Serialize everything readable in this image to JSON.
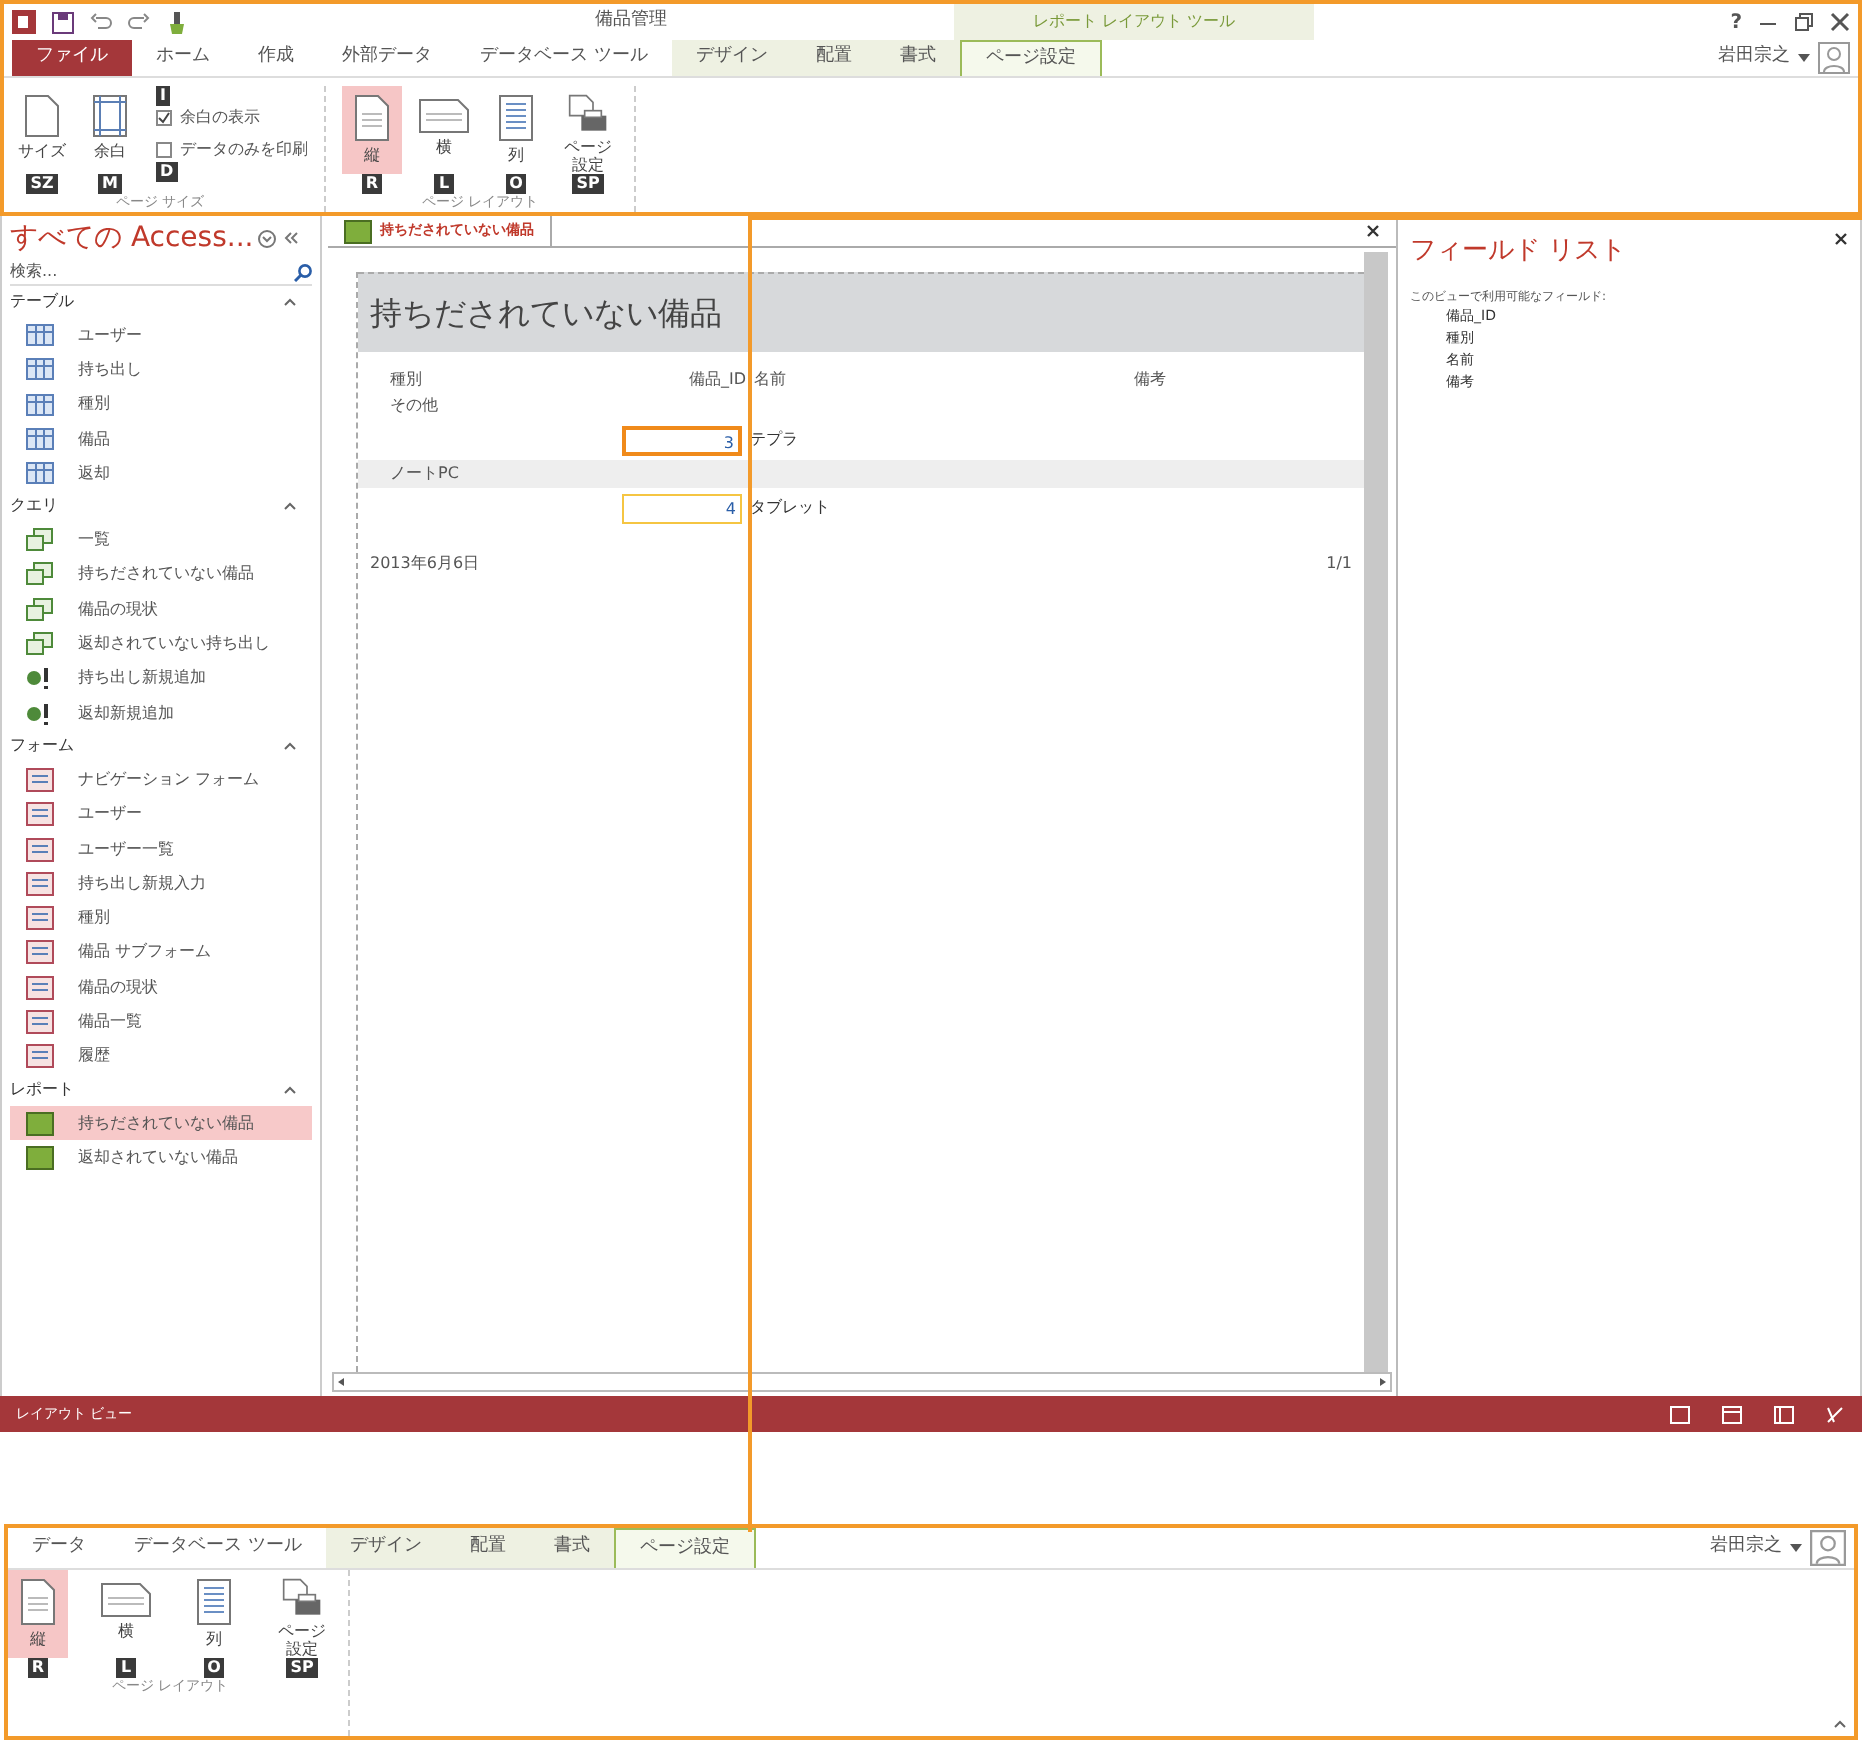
{
  "window": {
    "title": "備品管理",
    "context_tool": "レポート レイアウト ツール",
    "help": "?",
    "user": "岩田宗之"
  },
  "tabs": [
    {
      "label": "ファイル",
      "selected": false,
      "kind": "file"
    },
    {
      "label": "ホーム",
      "selected": false,
      "kind": "normal"
    },
    {
      "label": "作成",
      "selected": false,
      "kind": "normal"
    },
    {
      "label": "外部データ",
      "selected": false,
      "kind": "normal"
    },
    {
      "label": "データベース ツール",
      "selected": false,
      "kind": "normal"
    },
    {
      "label": "デザイン",
      "selected": false,
      "kind": "context"
    },
    {
      "label": "配置",
      "selected": false,
      "kind": "context"
    },
    {
      "label": "書式",
      "selected": false,
      "kind": "context"
    },
    {
      "label": "ページ設定",
      "selected": true,
      "kind": "context"
    }
  ],
  "ribbon": {
    "page_size": {
      "label": "ページ サイズ",
      "buttons": [
        {
          "label": "サイズ",
          "key": "SZ"
        },
        {
          "label": "余白",
          "key": "M"
        }
      ],
      "checks": [
        {
          "label": "余白の表示",
          "checked": true,
          "key": "I"
        },
        {
          "label": "データのみを印刷",
          "checked": false,
          "key": "D"
        }
      ]
    },
    "page_layout": {
      "label": "ページ レイアウト",
      "buttons": [
        {
          "label": "縦",
          "key": "R",
          "selected": true
        },
        {
          "label": "横",
          "key": "L",
          "selected": false
        },
        {
          "label": "列",
          "key": "O",
          "selected": false
        },
        {
          "label": "ページ設定",
          "key": "SP",
          "selected": false
        }
      ]
    }
  },
  "nav": {
    "title": "すべての Access...",
    "search": {
      "placeholder": "検索..."
    },
    "sections": [
      {
        "label": "テーブル",
        "items": [
          {
            "label": "ユーザー",
            "kind": "table",
            "selected": false
          },
          {
            "label": "持ち出し",
            "kind": "table",
            "selected": false
          },
          {
            "label": "種別",
            "kind": "table",
            "selected": false
          },
          {
            "label": "備品",
            "kind": "table",
            "selected": false
          },
          {
            "label": "返却",
            "kind": "table",
            "selected": false
          }
        ]
      },
      {
        "label": "クエリ",
        "items": [
          {
            "label": "一覧",
            "kind": "query",
            "selected": false
          },
          {
            "label": "持ちだされていない備品",
            "kind": "query",
            "selected": false
          },
          {
            "label": "備品の現状",
            "kind": "query",
            "selected": false
          },
          {
            "label": "返却されていない持ち出し",
            "kind": "query",
            "selected": false
          },
          {
            "label": "持ち出し新規追加",
            "kind": "append",
            "selected": false
          },
          {
            "label": "返却新規追加",
            "kind": "append",
            "selected": false
          }
        ]
      },
      {
        "label": "フォーム",
        "items": [
          {
            "label": "ナビゲーション フォーム",
            "kind": "form",
            "selected": false
          },
          {
            "label": "ユーザー",
            "kind": "form",
            "selected": false
          },
          {
            "label": "ユーザー一覧",
            "kind": "form",
            "selected": false
          },
          {
            "label": "持ち出し新規入力",
            "kind": "form",
            "selected": false
          },
          {
            "label": "種別",
            "kind": "form",
            "selected": false
          },
          {
            "label": "備品 サブフォーム",
            "kind": "form",
            "selected": false
          },
          {
            "label": "備品の現状",
            "kind": "form",
            "selected": false
          },
          {
            "label": "備品一覧",
            "kind": "form",
            "selected": false
          },
          {
            "label": "履歴",
            "kind": "form",
            "selected": false
          }
        ]
      },
      {
        "label": "レポート",
        "items": [
          {
            "label": "持ちだされていない備品",
            "kind": "report",
            "selected": true
          },
          {
            "label": "返却されていない備品",
            "kind": "report",
            "selected": false
          }
        ]
      }
    ]
  },
  "document": {
    "tab": "持ちだされていない備品",
    "report": {
      "title": "持ちだされていない備品",
      "columns": [
        "種別",
        "備品_ID",
        "名前",
        "備考"
      ],
      "groups": [
        {
          "category": "その他",
          "rows": [
            {
              "id": "3",
              "name": "テプラ",
              "selected": true
            }
          ]
        },
        {
          "category": "ノートPC",
          "rows": [
            {
              "id": "4",
              "name": "タブレット",
              "selected": false
            }
          ]
        }
      ],
      "date": "2013年6月6日",
      "page": "1/1"
    }
  },
  "field_list": {
    "title": "フィールド リスト",
    "caption": "このビューで利用可能なフィールド:",
    "fields": [
      "備品_ID",
      "種別",
      "名前",
      "備考"
    ]
  },
  "status_bar": {
    "text": "レイアウト ビュー"
  },
  "inset": {
    "tabs": [
      {
        "label": "データ",
        "selected": false,
        "kind": "normal"
      },
      {
        "label": "データベース ツール",
        "selected": false,
        "kind": "normal"
      },
      {
        "label": "デザイン",
        "selected": false,
        "kind": "context"
      },
      {
        "label": "配置",
        "selected": false,
        "kind": "context"
      },
      {
        "label": "書式",
        "selected": false,
        "kind": "context"
      },
      {
        "label": "ページ設定",
        "selected": true,
        "kind": "context"
      }
    ],
    "user": "岩田宗之",
    "group_label": "ページ レイアウト",
    "buttons": [
      {
        "label": "縦",
        "key": "R",
        "selected": true
      },
      {
        "label": "横",
        "key": "L",
        "selected": false
      },
      {
        "label": "列",
        "key": "O",
        "selected": false
      },
      {
        "label": "ページ設定",
        "key": "SP",
        "selected": false
      }
    ]
  }
}
